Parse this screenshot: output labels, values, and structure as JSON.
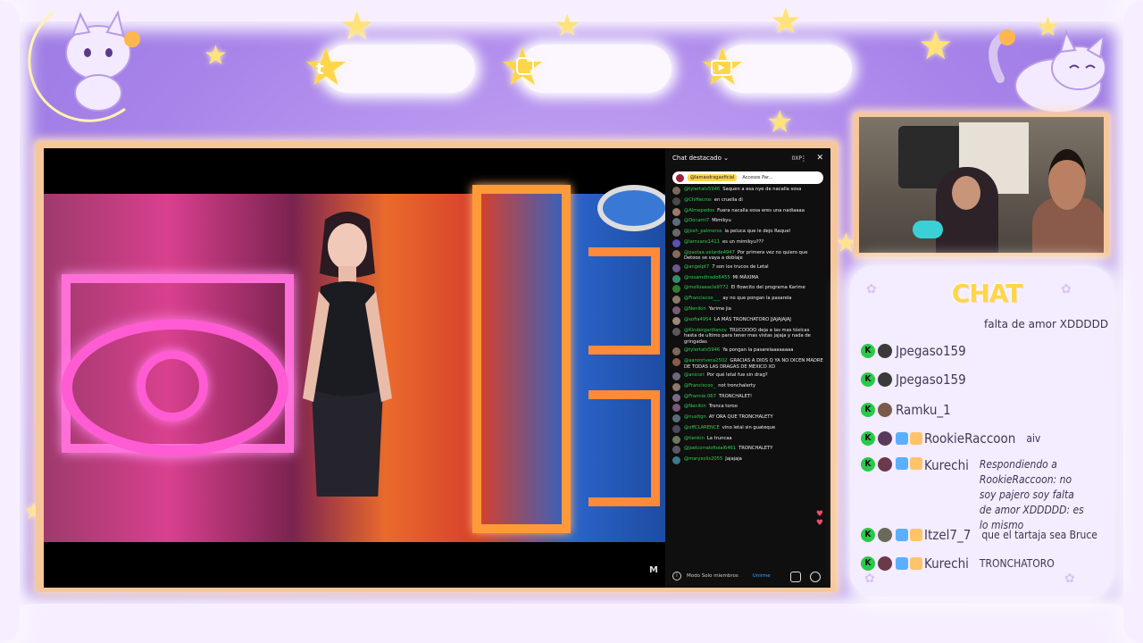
{
  "video_chat": {
    "title": "Chat destacado",
    "xp_label": "0XP",
    "pinned_user": "@lamasdragaoficial",
    "pinned_text": "Accesos Par...",
    "footer_mode": "Modo Solo miembros",
    "footer_join": "Unirme",
    "messages": [
      {
        "user": "@tylertats5946",
        "text": "Saquen a esa nye de nacalla sosa",
        "avatar_color": "#7a6a5a"
      },
      {
        "user": "@Chifiecros",
        "text": "en cruella di",
        "avatar_color": "#4a4a4a"
      },
      {
        "user": "@Almepedos",
        "text": "Fuera nacalla sosa eres una nadiaaaa",
        "avatar_color": "#9b7b6a"
      },
      {
        "user": "@Docami7",
        "text": "Mimikyu",
        "avatar_color": "#5d6b7a"
      },
      {
        "user": "@josh_palmeros",
        "text": "la peluca que le dejo Raquel",
        "avatar_color": "#6a6a6a"
      },
      {
        "user": "@lamsans1411",
        "text": "es un mimikyu???",
        "avatar_color": "#5b4fb8"
      },
      {
        "user": "@paolaa.velarde4947",
        "text": "Por primera vez no quiero que Detoox se vaya a doblaje",
        "avatar_color": "#8a6a5a"
      },
      {
        "user": "@angelpt7",
        "text": "7 son los trucos de Letal",
        "avatar_color": "#6b5a8a"
      },
      {
        "user": "@rosamdtrado6455",
        "text": "MI MÁXIMA",
        "avatar_color": "#3a8a6a"
      },
      {
        "user": "@molloaeacle9772",
        "text": "El flowcito del programa Karime",
        "avatar_color": "#2e7d32"
      },
      {
        "user": "@Franciscoo___",
        "text": "ay no que pongan la pasarela",
        "avatar_color": "#8a7a6a"
      },
      {
        "user": "@Nenikin",
        "text": "Yarime jia",
        "avatar_color": "#7a5a7a"
      },
      {
        "user": "@sofia4954",
        "text": "LA MÁS TRONCHATORO JJAJAJAJAJ",
        "avatar_color": "#9a8a7a"
      },
      {
        "user": "@Kindergardianov",
        "text": "TRUCOOOO deja a las mas tóxicas hasta de ultimo para tener mas vistas jajaja y nada de gringadas",
        "avatar_color": "#5a5a5a"
      },
      {
        "user": "@tylertats5946",
        "text": "Ya pongan la pasarelaaaaaaaa",
        "avatar_color": "#7a6a5a"
      },
      {
        "user": "@aaronrivera2502",
        "text": "GRACIAS A DIOS Q YA NO DICEN MADRE DE TODAS LAS DRAGAS DE MEXICO XD",
        "avatar_color": "#8a5a4a"
      },
      {
        "user": "@anicori",
        "text": "Por qué letal fue sin drag?",
        "avatar_color": "#6a6a7a"
      },
      {
        "user": "@Franciscoo_",
        "text": "not tronchalerty",
        "avatar_color": "#8a7a6a"
      },
      {
        "user": "@Frannie.067",
        "text": "TRONCHALET!",
        "avatar_color": "#7a6a8a"
      },
      {
        "user": "@Nenikin",
        "text": "Tronca toroo",
        "avatar_color": "#7a5a7a"
      },
      {
        "user": "@nuxitgn",
        "text": "AY ORA QUE TRONCHALETY",
        "avatar_color": "#5a6a7a"
      },
      {
        "user": "@offCLARENCE",
        "text": "vino letal sin guateque",
        "avatar_color": "#4a4a5a"
      },
      {
        "user": "@tienkin",
        "text": "La truncaa",
        "avatar_color": "#6a7a5a"
      },
      {
        "user": "@joelcorralofioial6461",
        "text": "TRONCHALETY",
        "avatar_color": "#5a5a6a"
      },
      {
        "user": "@marysolis2055",
        "text": "Jajajaja",
        "avatar_color": "#3a7a8a"
      }
    ]
  },
  "side_chat": {
    "title": "CHAT",
    "partial_top": "falta de amor XDDDDD",
    "rows": [
      {
        "name": "Jpegaso159",
        "msg": "",
        "avatar_color": "#3a3a3a"
      },
      {
        "name": "Jpegaso159",
        "msg": "",
        "avatar_color": "#3a3a3a"
      },
      {
        "name": "Ramku_1",
        "msg": "",
        "avatar_color": "#7a5a4a"
      },
      {
        "name": "RookieRaccoon",
        "msg": "aiv",
        "avatar_color": "#5a3a5a"
      },
      {
        "name": "Kurechi",
        "msg": "Respondiendo a RookieRaccoon: no soy pajero soy falta de amor XDDDDD: es lo mismo",
        "avatar_color": "#6a3a4a"
      },
      {
        "name": "Itzel7_7",
        "msg": "que el tartaja sea Bruce",
        "avatar_color": "#6a6a5a"
      },
      {
        "name": "Kurechi",
        "msg": "TRONCHATORO",
        "avatar_color": "#6a3a4a"
      }
    ]
  },
  "social_icons": [
    "twitter-icon",
    "instagram-icon",
    "youtube-icon"
  ],
  "colors": {
    "accent_yellow": "#ffd54a",
    "chat_green": "#2fcf4f",
    "frame_peach": "#f6c79b",
    "bg_purple": "#a985ea"
  }
}
